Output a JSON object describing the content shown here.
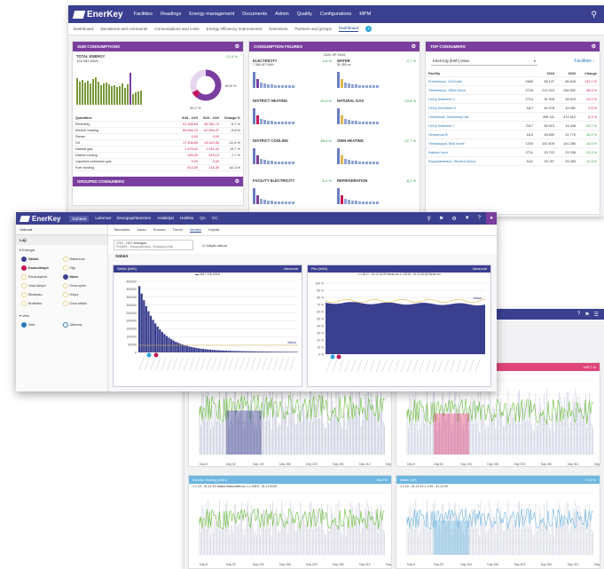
{
  "app": {
    "brand": "EnerKey"
  },
  "w1": {
    "nav": [
      "Facilities",
      "Readings",
      "Energy management",
      "Documents",
      "Admin",
      "Quality",
      "Configurations",
      "MPM"
    ],
    "tabs": [
      "Dashboard",
      "Deviations and comments",
      "Consumptions and costs",
      "Energy efficiency improvement",
      "Emissions",
      "Partners and groups",
      "Dashboard"
    ],
    "sum": {
      "header": "SUM CONSUMPTIONS",
      "total_label": "TOTAL ENERGY",
      "total_value": "126 983 MWh",
      "total_change": "-13,4 %",
      "pie_pct": "60,8 %",
      "pie_bottom": "39,2 %",
      "cols": [
        "Quantities",
        "3/18 - 2/19",
        "3/19 - 2/20",
        "Change %"
      ],
      "rows": [
        [
          "Electricity",
          "51 338,84",
          "46 351,72",
          "-9,7 %"
        ],
        [
          "Electric heating",
          "69 646,22",
          "62 894,47",
          "-9,8 %"
        ],
        [
          "Steam",
          "0,00",
          "0,00",
          ""
        ],
        [
          "Oil",
          "17 408,80",
          "13 520,55",
          "-22,6 %"
        ],
        [
          "Natural gas",
          "1 676,62",
          "2 011,40",
          "19,7 %"
        ],
        [
          "District cooling",
          "345,40",
          "319,13",
          "-7,7 %"
        ],
        [
          "Liquefied petroleum gas",
          "0,00",
          "0,00",
          ""
        ],
        [
          "Fuel heating",
          "513,39",
          "116,35",
          "-62,3 %"
        ]
      ],
      "grouped_header": "GROUPED CONSUMERS"
    },
    "figures": {
      "header": "CONSUMPTION FIGURES",
      "period": "2020 3P 2019",
      "items": [
        {
          "name": "ELECTRICITY",
          "value": "7 365 517 kWh",
          "change": "-4,8 %"
        },
        {
          "name": "WATER",
          "value": "80 350 m³",
          "change": "-2,7 %"
        },
        {
          "name": "DISTRICT HEATING",
          "value": "",
          "change": "-32,8 %"
        },
        {
          "name": "NATURAL GAS",
          "value": "",
          "change": "-10,8 %"
        },
        {
          "name": "DISTRICT COOLING",
          "value": "",
          "change": "-56,6 %"
        },
        {
          "name": "OWN HEATING",
          "value": "",
          "change": "-37,7 %"
        },
        {
          "name": "FACILITY ELECTRICITY",
          "value": "",
          "change": "-6,2 %"
        },
        {
          "name": "REFRIGERATION",
          "value": "",
          "change": "-6,2 %"
        }
      ]
    },
    "top": {
      "header": "TOP CONSUMERS",
      "select": "Electricity [kWh] Value",
      "link": "Facilities",
      "cols": [
        "Facility",
        "",
        "2019",
        "2020",
        "Change"
      ],
      "rows": [
        [
          "Enerkeskus, OxCentre",
          "4669",
          "38 147",
          "66 643",
          "131,1 %"
        ],
        [
          "Tietokeskus, Office block",
          "2718",
          "212 223",
          "284 652",
          "58,5 %"
        ],
        [
          "HoOy Kotikanto 4",
          "2714",
          "31 928",
          "38 623",
          "29,0 %"
        ],
        [
          "HoOy Kunnikatu 6",
          "1117",
          "40 078",
          "44 082",
          "9,6 %"
        ],
        [
          "Urheiluhalli, Swimming hall",
          "",
          "498 111",
          "474 412",
          "6,3 %"
        ],
        [
          "HoOy Kotikanto 7",
          "2117",
          "58 313",
          "44 408",
          "-20,7 %"
        ],
        [
          "Virkaseura B",
          "1119",
          "28 699",
          "21 770",
          "-15,4 %"
        ],
        [
          "Yleiskauppa, Bazi home",
          "1234",
          "167 878",
          "141 280",
          "-15,6 %"
        ],
        [
          "Kakkari hoch",
          "2711",
          "33 722",
          "29 238",
          "-13,3 %"
        ],
        [
          "Kappalakartano, Student dorms",
          "1111",
          "28 767",
          "25 083",
          "-12,8 %"
        ]
      ]
    }
  },
  "w2": {
    "nav": [
      "Kohteet",
      "Lukemat",
      "Energiajohtaminen",
      "Asiakirjat",
      "Hallinta",
      "QA",
      "CC"
    ],
    "subtabs": [
      "Tarkastelu",
      "Jakso",
      "Summa",
      "Trendi",
      "Vertailu",
      "Kirjoita"
    ],
    "left_title": "Valinnat",
    "left_subtitle": "Laji",
    "energy_label": "Energia",
    "energy": [
      {
        "name": "Sähkö",
        "on": true,
        "color": "#3a3f8f"
      },
      {
        "name": "Rakennus",
        "on": false,
        "color": "#e8d48a"
      },
      {
        "name": "Kaukolämpö",
        "on": true,
        "color": "#c2185b"
      },
      {
        "name": "Öljy",
        "on": false,
        "color": "#e8d48a"
      },
      {
        "name": "Kaukokylmä",
        "on": false,
        "color": "#e8d48a"
      },
      {
        "name": "Maxx",
        "on": true,
        "color": "#3a3f8f"
      },
      {
        "name": "Oma lämpö",
        "on": false,
        "color": "#e8d48a"
      },
      {
        "name": "Oma sytne",
        "on": false,
        "color": "#e8d48a"
      },
      {
        "name": "Biokaasu",
        "on": false,
        "color": "#e8d48a"
      },
      {
        "name": "Höyry",
        "on": false,
        "color": "#e8d48a"
      },
      {
        "name": "Bruttobio",
        "on": false,
        "color": "#e8d48a"
      },
      {
        "name": "Oma sähkö",
        "on": false,
        "color": "#e8d48a"
      }
    ],
    "water_label": "Vesi",
    "water": [
      {
        "name": "Vesi",
        "on": true
      },
      {
        "name": "Jätevesi",
        "on": false
      }
    ],
    "filter_entity": "1721 - HO+ Armegan",
    "filter_sub": "P00683 - Kauppakeskus, Shopping mall",
    "filter_check": "Näytä valinat",
    "section_title": "Sähkö",
    "chart1": {
      "title": "Sähkö [kWh]",
      "legend": "2017 1/6 2018",
      "axis_label": "Sähkö",
      "ymax": 450000,
      "btn": "Jakaumat"
    },
    "chart2": {
      "title": "Piko [kWh]",
      "legend": "1.1.2017 - 31.12.2019 Paivia mn   1.1.2018 - 31.12.2018 Paivia mn",
      "axis_label": "Vaaka",
      "btn": "Jakaumat"
    }
  },
  "w3": {
    "p1_badge": "+69,7 %",
    "p1_legend": "1.1.2019 - 31.12.2019   1.1.2020 - 31.12.2020",
    "p3_title": "Electric heating [kWh]",
    "p3_badge": "-36,0 %",
    "p3_legend": "1.1.19 - 31.12.19   Vaaka Maavuotta luu 1.1.2019 - 31.12.2019",
    "p4_title": "Water [m³]",
    "p4_badge": "-74,6 %",
    "p4_legend": "1.1.19 - 31.12.19   1.1.20 - 31.12.20",
    "xticks": [
      "Day 8",
      "Day 52",
      "Day 104",
      "Day 156",
      "Day 203",
      "Day 260",
      "Day 312",
      "Day 349"
    ]
  }
}
